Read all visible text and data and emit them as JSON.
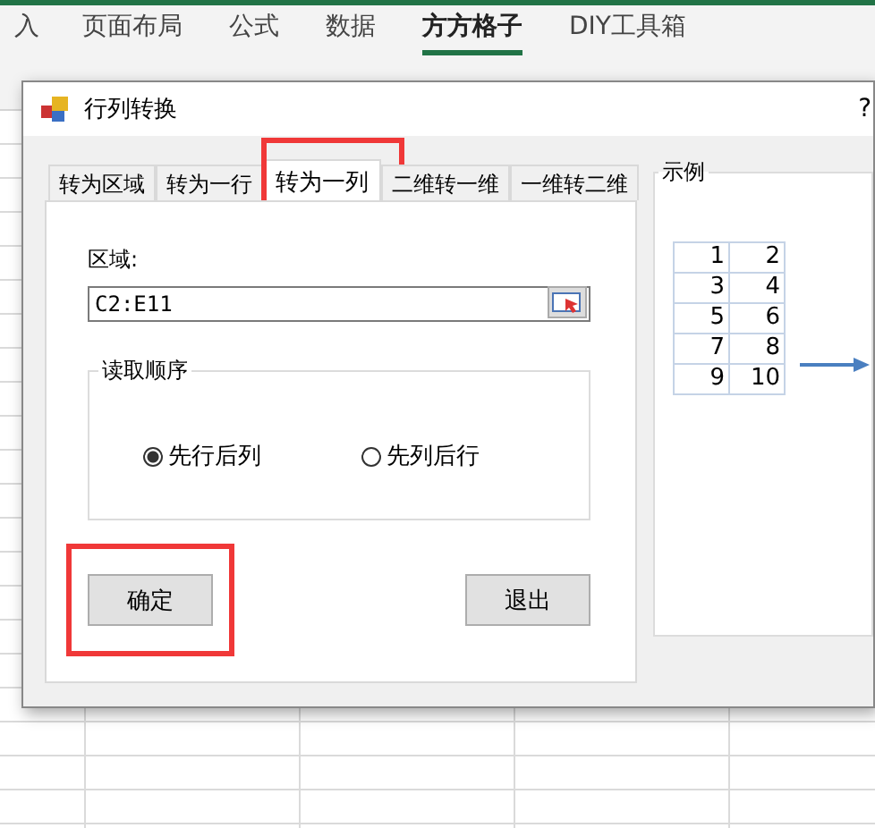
{
  "ribbon_tabs": [
    {
      "label": "入",
      "selected": false
    },
    {
      "label": "页面布局",
      "selected": false
    },
    {
      "label": "公式",
      "selected": false
    },
    {
      "label": "数据",
      "selected": false
    },
    {
      "label": "方方格子",
      "selected": true
    },
    {
      "label": "DIY工具箱",
      "selected": false
    }
  ],
  "dialog": {
    "title": "行列转换",
    "help": "?",
    "tabs": [
      {
        "label": "转为区域",
        "selected": false
      },
      {
        "label": "转为一行",
        "selected": false
      },
      {
        "label": "转为一列",
        "selected": true
      },
      {
        "label": "二维转一维",
        "selected": false
      },
      {
        "label": "一维转二维",
        "selected": false
      }
    ],
    "range_label": "区域:",
    "range_value": "C2:E11",
    "order_group": {
      "title": "读取顺序",
      "options": [
        {
          "label": "先行后列",
          "selected": true
        },
        {
          "label": "先列后行",
          "selected": false
        }
      ]
    },
    "buttons": [
      {
        "label": "确定",
        "highlighted": true
      },
      {
        "label": "退出",
        "highlighted": false
      }
    ],
    "example": {
      "title": "示例",
      "rows": [
        [
          "1",
          "2"
        ],
        [
          "3",
          "4"
        ],
        [
          "5",
          "6"
        ],
        [
          "7",
          "8"
        ],
        [
          "9",
          "10"
        ]
      ]
    }
  }
}
